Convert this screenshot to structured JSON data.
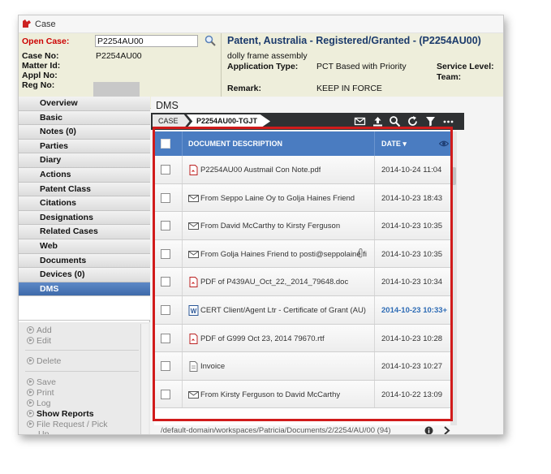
{
  "window": {
    "title": "Case"
  },
  "header": {
    "open_case_label": "Open Case:",
    "open_case_value": "P2254AU00",
    "case_no_label": "Case No:",
    "case_no_value": "P2254AU00",
    "matter_id_label": "Matter Id:",
    "appl_no_label": "Appl No:",
    "reg_no_label": "Reg No:",
    "case_title": "Patent, Australia - Registered/Granted - (P2254AU00)",
    "subtitle": "dolly frame assembly",
    "application_type_label": "Application Type:",
    "application_type_value": "PCT Based with Priority",
    "service_level_label": "Service Level:",
    "team_label": "Team:",
    "remark_label": "Remark:",
    "remark_value": "KEEP IN FORCE"
  },
  "nav": {
    "items": [
      {
        "label": "Overview"
      },
      {
        "label": "Basic"
      },
      {
        "label": "Notes (0)"
      },
      {
        "label": "Parties"
      },
      {
        "label": "Diary"
      },
      {
        "label": "Actions"
      },
      {
        "label": "Patent Class"
      },
      {
        "label": "Citations"
      },
      {
        "label": "Designations"
      },
      {
        "label": "Related Cases"
      },
      {
        "label": "Web"
      },
      {
        "label": "Documents"
      },
      {
        "label": "Devices (0)"
      },
      {
        "label": "DMS"
      }
    ],
    "active": "DMS"
  },
  "actions": {
    "add": "Add",
    "edit": "Edit",
    "delete": "Delete",
    "save": "Save",
    "print": "Print",
    "log": "Log",
    "show_reports": "Show Reports",
    "file_request": "File Request / Pick",
    "file_request_cont": "Up"
  },
  "dms": {
    "title": "DMS",
    "breadcrumb_case": "CASE",
    "breadcrumb_id": "P2254AU00-TGJT",
    "icons": [
      "mail-icon",
      "upload-icon",
      "search-icon",
      "refresh-icon",
      "filter-icon",
      "more-icon"
    ],
    "columns": {
      "description": "DOCUMENT DESCRIPTION",
      "date": "DATE ▾"
    },
    "rows": [
      {
        "icon": "pdf",
        "name": "P2254AU00 Austmail Con Note.pdf",
        "date": "2014-10-24 11:04",
        "highlight": false,
        "attachment": false
      },
      {
        "icon": "mail",
        "name": "From Seppo Laine Oy to Golja Haines Friend",
        "date": "2014-10-23 18:43",
        "highlight": false,
        "attachment": false
      },
      {
        "icon": "mail",
        "name": "From David McCarthy to Kirsty Ferguson",
        "date": "2014-10-23 10:35",
        "highlight": false,
        "attachment": false
      },
      {
        "icon": "mail",
        "name": "From Golja Haines Friend to posti@seppolaine.fi",
        "date": "2014-10-23 10:35",
        "highlight": false,
        "attachment": true
      },
      {
        "icon": "pdf",
        "name": "PDF of P439AU_Oct_22,_2014_79648.doc",
        "date": "2014-10-23 10:34",
        "highlight": false,
        "attachment": false
      },
      {
        "icon": "word",
        "name": "CERT Client/Agent Ltr - Certificate of Grant (AU)",
        "date": "2014-10-23 10:33+",
        "highlight": true,
        "attachment": false
      },
      {
        "icon": "pdf",
        "name": "PDF of G999 Oct 23, 2014 79670.rtf",
        "date": "2014-10-23 10:28",
        "highlight": false,
        "attachment": false
      },
      {
        "icon": "doc",
        "name": "Invoice",
        "date": "2014-10-23 10:27",
        "highlight": false,
        "attachment": false
      },
      {
        "icon": "mail",
        "name": "From Kirsty Ferguson to David McCarthy",
        "date": "2014-10-22 13:09",
        "highlight": false,
        "attachment": false
      }
    ],
    "status_path": "/default-domain/workspaces/Patricia/Documents/2/2254/AU/00 (94)"
  },
  "colors": {
    "accent_blue": "#4a7cc1",
    "nav_active": "#4a78b8",
    "header_bg": "#eeeedb",
    "highlight_frame": "#d11b1b",
    "open_case_red": "#cc0000",
    "title_blue": "#1b3a6b"
  }
}
